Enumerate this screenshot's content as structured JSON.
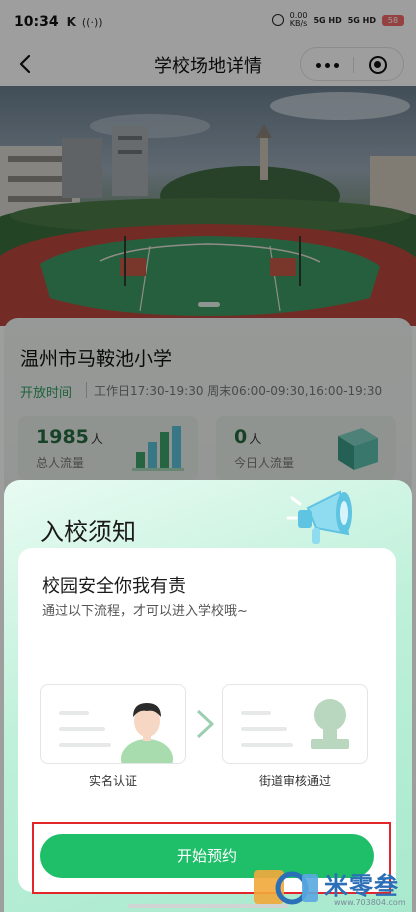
{
  "status_bar": {
    "time": "10:34",
    "k_label": "K",
    "net_speed": "0.00",
    "net_unit": "KB/s",
    "signal1": "5G HD",
    "signal2": "5G HD",
    "battery": "58"
  },
  "nav": {
    "title": "学校场地详情"
  },
  "school": {
    "name": "温州市马鞍池小学",
    "open_label": "开放时间",
    "open_times": "工作日17:30-19:30 周末06:00-09:30,16:00-19:30",
    "stats": [
      {
        "value": "1985",
        "unit": "人",
        "label": "总人流量"
      },
      {
        "value": "0",
        "unit": "人",
        "label": "今日人流量"
      }
    ]
  },
  "notice": {
    "title": "入校须知",
    "heading": "校园安全你我有责",
    "subheading": "通过以下流程，才可以进入学校哦~",
    "steps": [
      {
        "label": "实名认证"
      },
      {
        "label": "街道审核通过"
      }
    ],
    "button_label": "开始预约"
  },
  "watermark": {
    "text": "米零叁",
    "url": "www.703804.com"
  },
  "colors": {
    "accent_green": "#1fbf6a",
    "open_label": "#2f9f5c",
    "highlight_frame": "#e3262a"
  }
}
